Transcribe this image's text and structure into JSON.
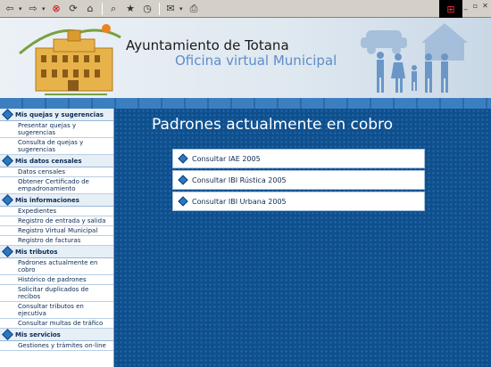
{
  "toolbar": {
    "buttons": [
      "back-icon",
      "forward-icon",
      "stop-icon",
      "refresh-icon",
      "home-icon",
      "search-icon",
      "favorites-icon",
      "history-icon",
      "mail-icon",
      "print-icon"
    ]
  },
  "header": {
    "title": "Ayuntamiento de Totana",
    "subtitle": "Oficina virtual Municipal"
  },
  "sidebar": {
    "sections": [
      {
        "title": "Mis quejas y sugerencias",
        "items": [
          "Presentar quejas y sugerencias",
          "Consulta de quejas y sugerencias"
        ]
      },
      {
        "title": "Mis datos censales",
        "items": [
          "Datos censales",
          "Obtener Certificado de empadronamiento"
        ]
      },
      {
        "title": "Mis informaciones",
        "items": [
          "Expedientes",
          "Registro de entrada y salida",
          "Registro Virtual Municipal",
          "Registro de facturas"
        ]
      },
      {
        "title": "Mis tributos",
        "items": [
          "Padrones actualmente en cobro",
          "Histórico de padrones",
          "Solicitar duplicados de recibos",
          "Consultar tributos en ejecutiva",
          "Consultar multas de tráfico"
        ]
      },
      {
        "title": "Mis servicios",
        "items": [
          "Gestiones y trámites on-line"
        ]
      }
    ]
  },
  "main": {
    "title": "Padrones actualmente en cobro",
    "links": [
      "Consultar IAE 2005",
      "Consultar IBI Rústica 2005",
      "Consultar IBI Urbana 2005"
    ]
  }
}
